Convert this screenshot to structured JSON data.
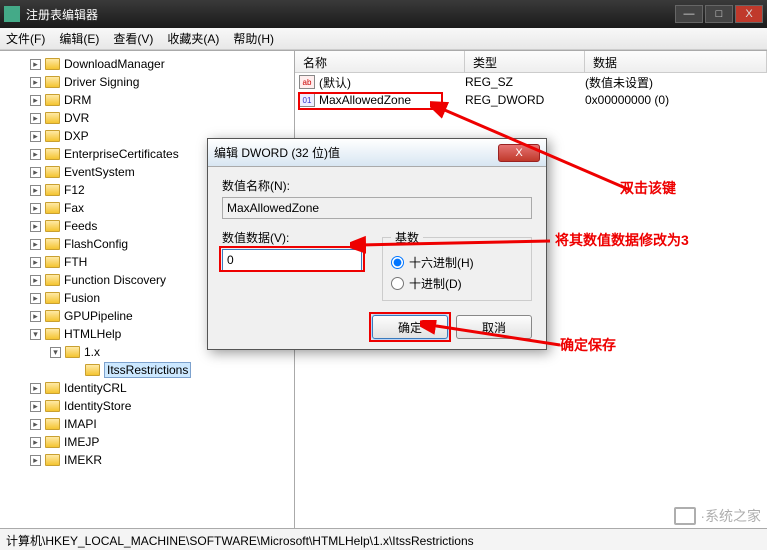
{
  "window": {
    "title": "注册表编辑器",
    "buttons": {
      "min": "—",
      "max": "□",
      "close": "X"
    }
  },
  "menu": {
    "file": "文件(F)",
    "edit": "编辑(E)",
    "view": "查看(V)",
    "fav": "收藏夹(A)",
    "help": "帮助(H)"
  },
  "tree": [
    {
      "l": 0,
      "t": "▸",
      "name": "DownloadManager"
    },
    {
      "l": 0,
      "t": "▸",
      "name": "Driver Signing"
    },
    {
      "l": 0,
      "t": "▸",
      "name": "DRM"
    },
    {
      "l": 0,
      "t": "▸",
      "name": "DVR"
    },
    {
      "l": 0,
      "t": "▸",
      "name": "DXP"
    },
    {
      "l": 0,
      "t": "▸",
      "name": "EnterpriseCertificates"
    },
    {
      "l": 0,
      "t": "▸",
      "name": "EventSystem"
    },
    {
      "l": 0,
      "t": "▸",
      "name": "F12"
    },
    {
      "l": 0,
      "t": "▸",
      "name": "Fax"
    },
    {
      "l": 0,
      "t": "▸",
      "name": "Feeds"
    },
    {
      "l": 0,
      "t": "▸",
      "name": "FlashConfig"
    },
    {
      "l": 0,
      "t": "▸",
      "name": "FTH"
    },
    {
      "l": 0,
      "t": "▸",
      "name": "Function Discovery"
    },
    {
      "l": 0,
      "t": "▸",
      "name": "Fusion"
    },
    {
      "l": 0,
      "t": "▸",
      "name": "GPUPipeline"
    },
    {
      "l": 0,
      "t": "▾",
      "name": "HTMLHelp"
    },
    {
      "l": 1,
      "t": "▾",
      "name": "1.x"
    },
    {
      "l": 2,
      "t": "",
      "name": "ItssRestrictions",
      "sel": true
    },
    {
      "l": 0,
      "t": "▸",
      "name": "IdentityCRL"
    },
    {
      "l": 0,
      "t": "▸",
      "name": "IdentityStore"
    },
    {
      "l": 0,
      "t": "▸",
      "name": "IMAPI"
    },
    {
      "l": 0,
      "t": "▸",
      "name": "IMEJP"
    },
    {
      "l": 0,
      "t": "▸",
      "name": "IMEKR"
    }
  ],
  "list": {
    "headers": {
      "name": "名称",
      "type": "类型",
      "data": "数据"
    },
    "rows": [
      {
        "icon": "ab",
        "name": "(默认)",
        "type": "REG_SZ",
        "data": "(数值未设置)"
      },
      {
        "icon": "bin",
        "name": "MaxAllowedZone",
        "type": "REG_DWORD",
        "data": "0x00000000 (0)"
      }
    ]
  },
  "dialog": {
    "title": "编辑 DWORD (32 位)值",
    "name_label": "数值名称(N):",
    "name_value": "MaxAllowedZone",
    "data_label": "数值数据(V):",
    "data_value": "0",
    "base_legend": "基数",
    "hex": "十六进制(H)",
    "dec": "十进制(D)",
    "ok": "确定",
    "cancel": "取消"
  },
  "status": "计算机\\HKEY_LOCAL_MACHINE\\SOFTWARE\\Microsoft\\HTMLHelp\\1.x\\ItssRestrictions",
  "annotations": {
    "a1": "双击该键",
    "a2": "将其数值数据修改为3",
    "a3": "确定保存"
  },
  "watermark": "·系统之家"
}
